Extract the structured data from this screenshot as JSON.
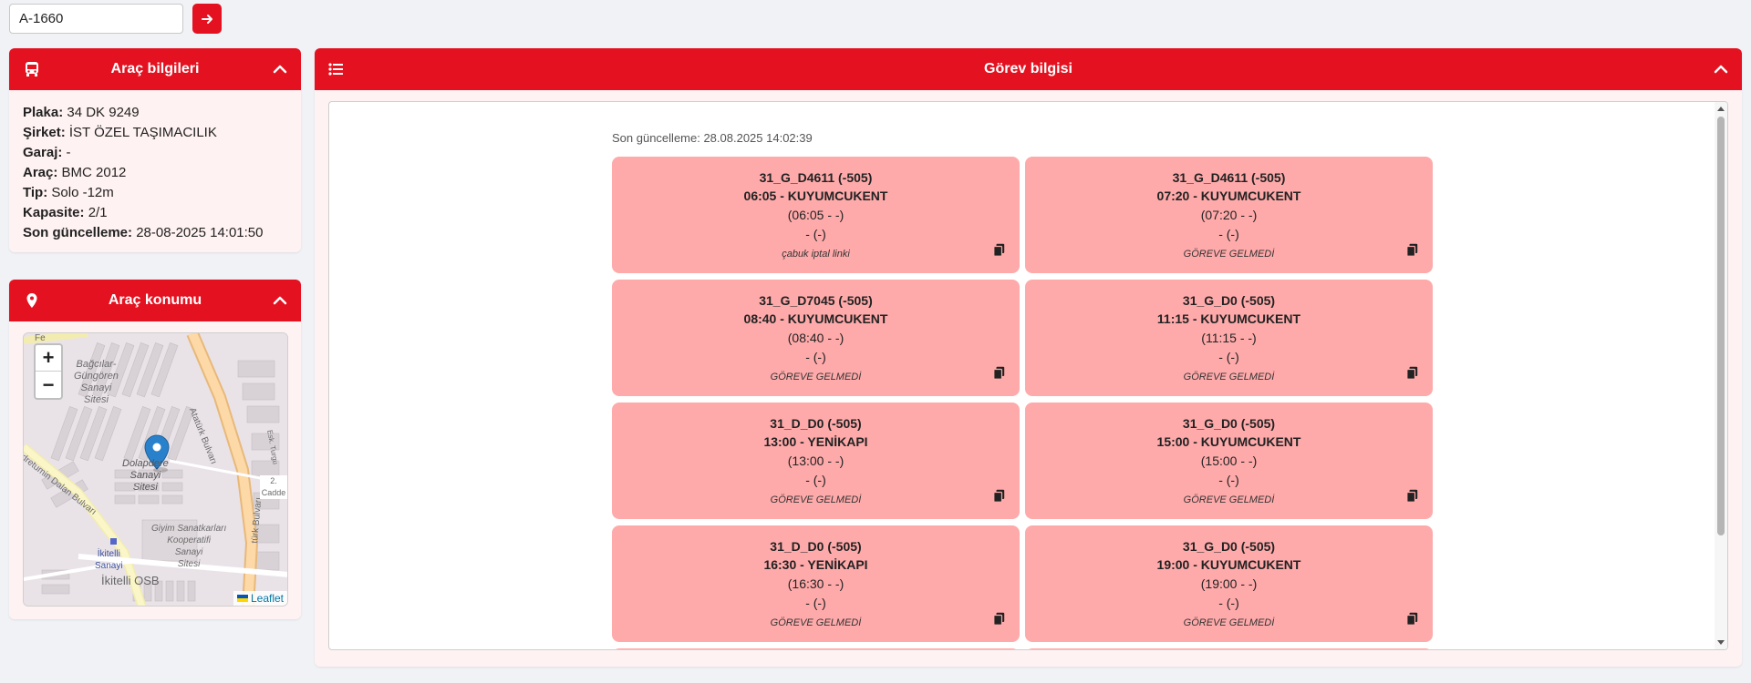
{
  "search": {
    "value": "A-1660"
  },
  "vehicle_panel": {
    "title": "Araç bilgileri",
    "fields": [
      {
        "label": "Plaka:",
        "value": "34 DK 9249"
      },
      {
        "label": "Şirket:",
        "value": "İST ÖZEL TAŞIMACILIK"
      },
      {
        "label": "Garaj:",
        "value": "-"
      },
      {
        "label": "Araç:",
        "value": "BMC 2012"
      },
      {
        "label": "Tip:",
        "value": "Solo -12m"
      },
      {
        "label": "Kapasite:",
        "value": "2/1"
      },
      {
        "label": "Son güncelleme:",
        "value": "28-08-2025 14:01:50"
      }
    ]
  },
  "location_panel": {
    "title": "Araç konumu",
    "zoom_in": "+",
    "zoom_out": "−",
    "attribution": "Leaflet",
    "map_labels": {
      "bagcilar": "Bağcılar-\nGüngören\nSanayi\nSitesi",
      "dolapdere": "Dolapdere\nSanayi\nSitesi",
      "giyim": "Giyim Sanatkarları\nKooperatifi\nSanayi\nSitesi",
      "ikitelli_sanayi": "İkitelli\nSanayi",
      "ikitelli_osb": "İkitelli OSB",
      "ataturk": "Atatürk Bulvarı",
      "ataturk2": "türk Bulvarı",
      "dalan": "dretumin Dalan Bulvarı",
      "cadde": "2. Cadde",
      "fe": "Fe",
      "esk": "Esk. Turgu"
    }
  },
  "task_panel": {
    "title": "Görev bilgisi",
    "last_update": "Son güncelleme: 28.08.2025 14:02:39",
    "cards": [
      {
        "code": "31_G_D4611 (-505)",
        "time_dest": "06:05 - KUYUMCUKENT",
        "planned": "(06:05 - -)",
        "actual": "- (-)",
        "status": "çabuk iptal linki"
      },
      {
        "code": "31_G_D4611 (-505)",
        "time_dest": "07:20 - KUYUMCUKENT",
        "planned": "(07:20 - -)",
        "actual": "- (-)",
        "status": "GÖREVE GELMEDİ"
      },
      {
        "code": "31_G_D7045 (-505)",
        "time_dest": "08:40 - KUYUMCUKENT",
        "planned": "(08:40 - -)",
        "actual": "- (-)",
        "status": "GÖREVE GELMEDİ"
      },
      {
        "code": "31_G_D0 (-505)",
        "time_dest": "11:15 - KUYUMCUKENT",
        "planned": "(11:15 - -)",
        "actual": "- (-)",
        "status": "GÖREVE GELMEDİ"
      },
      {
        "code": "31_D_D0 (-505)",
        "time_dest": "13:00 - YENİKAPI",
        "planned": "(13:00 - -)",
        "actual": "- (-)",
        "status": "GÖREVE GELMEDİ"
      },
      {
        "code": "31_G_D0 (-505)",
        "time_dest": "15:00 - KUYUMCUKENT",
        "planned": "(15:00 - -)",
        "actual": "- (-)",
        "status": "GÖREVE GELMEDİ"
      },
      {
        "code": "31_D_D0 (-505)",
        "time_dest": "16:30 - YENİKAPI",
        "planned": "(16:30 - -)",
        "actual": "- (-)",
        "status": "GÖREVE GELMEDİ"
      },
      {
        "code": "31_G_D0 (-505)",
        "time_dest": "19:00 - KUYUMCUKENT",
        "planned": "(19:00 - -)",
        "actual": "- (-)",
        "status": "GÖREVE GELMEDİ"
      }
    ]
  },
  "colors": {
    "accent": "#e41120",
    "card_bg": "#ffaaaa",
    "panel_bg": "#fff2f2"
  },
  "icons": [
    "bus-icon",
    "chevron-up-icon",
    "map-pin-icon",
    "list-icon",
    "copy-icon",
    "arrow-right-icon"
  ]
}
